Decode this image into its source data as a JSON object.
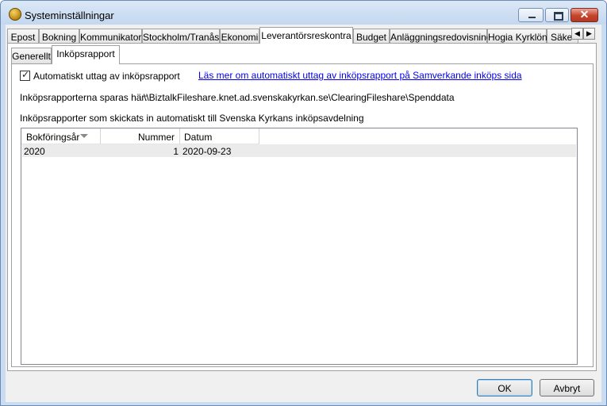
{
  "window": {
    "title": "Systeminställningar"
  },
  "tabs": [
    {
      "label": "Epost"
    },
    {
      "label": "Bokning"
    },
    {
      "label": "Kommunikator"
    },
    {
      "label": "Stockholm/Tranås"
    },
    {
      "label": "Ekonomi"
    },
    {
      "label": "Leverantörsreskontra",
      "active": true
    },
    {
      "label": "Budget"
    },
    {
      "label": "Anläggningsredovisning"
    },
    {
      "label": "Hogia Kyrklön"
    },
    {
      "label": "Säke"
    }
  ],
  "subtabs": [
    {
      "label": "Generellt"
    },
    {
      "label": "Inköpsrapport",
      "active": true
    }
  ],
  "auto_export": {
    "checked": true,
    "check_mark": "✓",
    "label": "Automatiskt uttag av inköpsrapport",
    "link": "Läs mer om automatiskt uttag av inköpsrapport på Samverkande inköps sida"
  },
  "storage": {
    "label": "Inköpsrapporterna sparas här:",
    "path": "\\\\BiztalkFileshare.knet.ad.svenskakyrkan.se\\ClearingFileshare\\Spenddata"
  },
  "reports": {
    "caption": "Inköpsrapporter som skickats in automatiskt till Svenska Kyrkans inköpsavdelning",
    "columns": {
      "year": "Bokföringsår",
      "number": "Nummer",
      "date": "Datum"
    },
    "rows": [
      {
        "year": "2020",
        "number": "1",
        "date": "2020-09-23"
      }
    ]
  },
  "buttons": {
    "ok": "OK",
    "cancel": "Avbryt"
  },
  "colors": {
    "accent": "#3c7fb1",
    "link": "#0000ee",
    "close": "#c7432b"
  }
}
